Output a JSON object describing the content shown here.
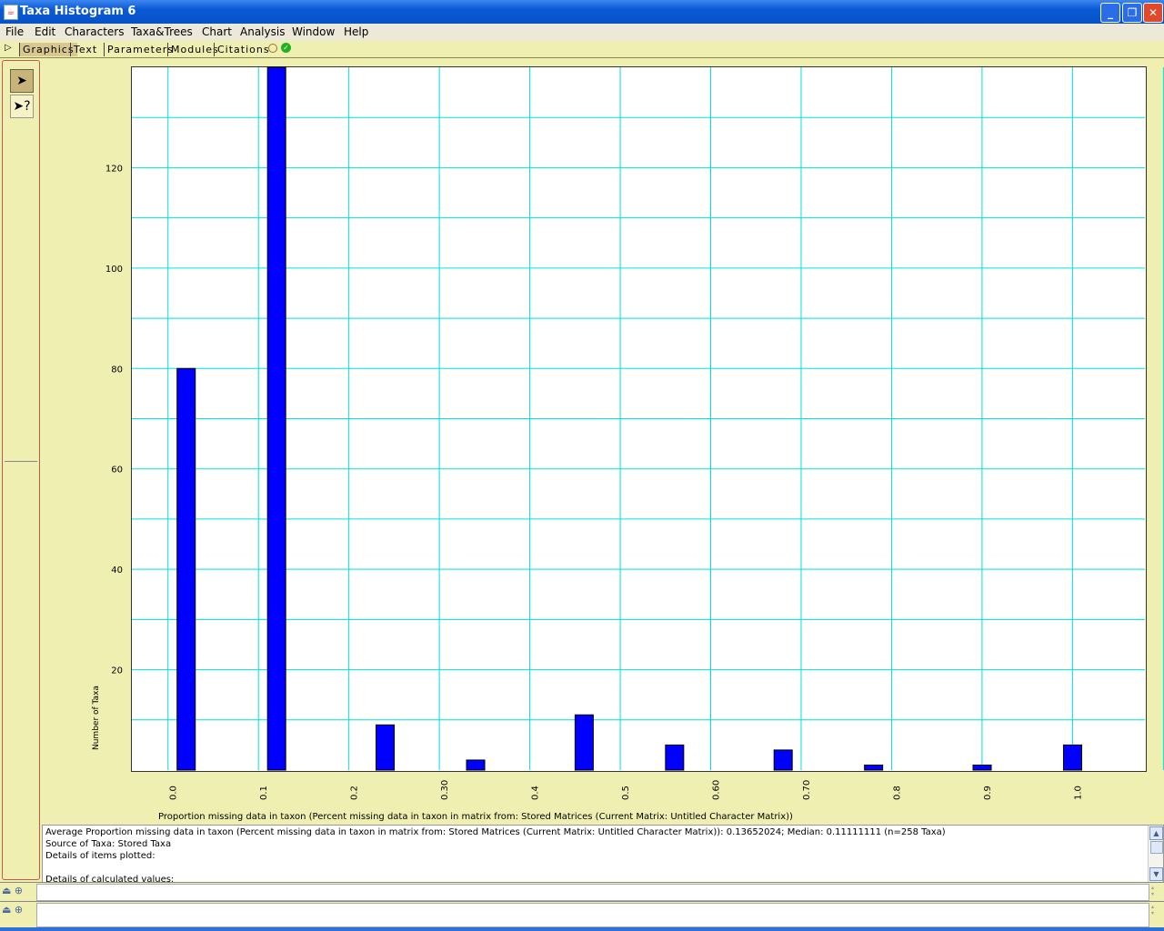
{
  "window": {
    "title": "Taxa Histogram 6"
  },
  "menu": [
    "File",
    "Edit",
    "Characters",
    "Taxa&Trees",
    "Chart",
    "Analysis",
    "Window",
    "Help"
  ],
  "tabs": [
    "Graphics",
    "Text",
    "Parameters",
    "Modules",
    "Citations"
  ],
  "tools": {
    "arrow": "arrow-tool-icon",
    "help": "help-arrow-tool-icon"
  },
  "colors": {
    "bar": "#0000ff",
    "grid": "#00e0e0",
    "panel": "#f0efb2"
  },
  "chart_data": {
    "type": "bar",
    "xlabel": "Proportion missing data in taxon (Percent missing data in taxon in matrix from: Stored Matrices (Current Matrix: Untitled Character Matrix))",
    "ylabel": "Number of Taxa",
    "x_ticks": [
      "0.0",
      "0.1",
      "0.2",
      "0.30",
      "0.4",
      "0.5",
      "0.60",
      "0.70",
      "0.8",
      "0.9",
      "1.0"
    ],
    "y_ticks": [
      "20",
      "40",
      "60",
      "80",
      "100",
      "120"
    ],
    "xlim": [
      -0.05,
      1.07
    ],
    "ylim": [
      0,
      140
    ],
    "bars": [
      {
        "x": 0.0,
        "y": 80
      },
      {
        "x": 0.1,
        "y": 140
      },
      {
        "x": 0.22,
        "y": 9
      },
      {
        "x": 0.32,
        "y": 2
      },
      {
        "x": 0.44,
        "y": 11
      },
      {
        "x": 0.54,
        "y": 5
      },
      {
        "x": 0.66,
        "y": 4
      },
      {
        "x": 0.76,
        "y": 1
      },
      {
        "x": 0.88,
        "y": 1
      },
      {
        "x": 0.98,
        "y": 5
      }
    ],
    "grid": true
  },
  "info": {
    "line1": "Average Proportion missing data in taxon (Percent missing data in taxon in matrix from: Stored Matrices (Current Matrix: Untitled Character Matrix)): 0.13652024; Median: 0.11111111  (n=258  Taxa)",
    "line2": "Source of  Taxa: Stored Taxa",
    "line3": "Details of items plotted:",
    "line4": "",
    "line5": "Details of  calculated values:"
  }
}
